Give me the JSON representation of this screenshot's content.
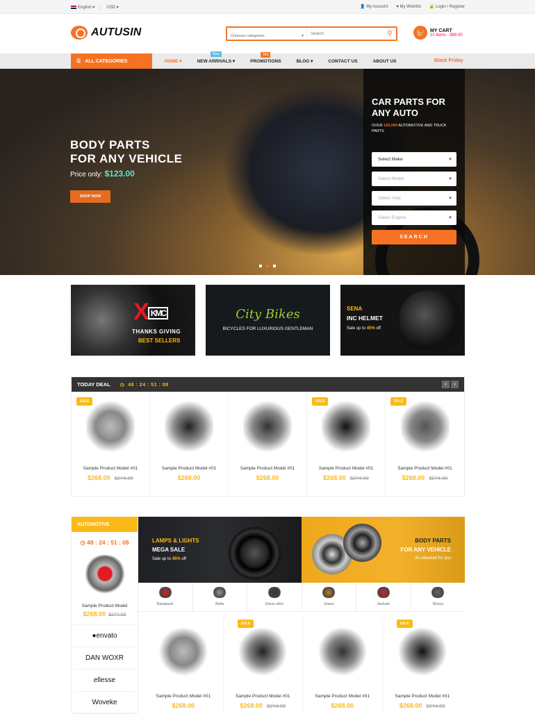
{
  "topbar": {
    "language": "English",
    "currency": "USD",
    "account": "My Account",
    "wishlist": "My Wishlist",
    "login": "Login / Register"
  },
  "header": {
    "logo": "AUTUSIN",
    "search_category": "Chooses categories",
    "search_placeholder": "Search",
    "cart_title": "MY CART",
    "cart_summary": "10 Items - $99.00"
  },
  "nav": {
    "all_categories": "ALL CATEGORIES",
    "items": [
      {
        "label": "HOME",
        "caret": "▾",
        "active": true,
        "badge": ""
      },
      {
        "label": "NEW ARRIVALS",
        "caret": "▾",
        "badge": "New"
      },
      {
        "label": "PROMOTIONS",
        "caret": "",
        "badge": "Hot"
      },
      {
        "label": "BLOG",
        "caret": "▾",
        "badge": ""
      },
      {
        "label": "CONTACT US",
        "caret": "",
        "badge": ""
      },
      {
        "label": "ABOUT US",
        "caret": "",
        "badge": ""
      }
    ],
    "promo": "Black Friday"
  },
  "hero": {
    "title_line1": "BODY PARTS",
    "title_line2": "FOR ANY VEHICLE",
    "price_label": "Price only:",
    "price": "$123.00",
    "cta": "SHOP NOW",
    "slides": 3,
    "active_slide": 2,
    "finder": {
      "title_line1": "CAR PARTS FOR",
      "title_line2": "ANY AUTO",
      "sub_prefix": "OVER",
      "sub_count": "120,000",
      "sub_suffix": "AUTOMOTIVE AND TRUCK PARTS",
      "selects": [
        "Select Make",
        "Select Model",
        "Select Year",
        "Select Engine"
      ],
      "button": "SEARCH"
    }
  },
  "banners": [
    {
      "logo": "XD",
      "logo_sub": "KMC",
      "line1": "THANKS GIVING",
      "line2": "BEST SELLERS"
    },
    {
      "title": "City Bikes",
      "subtitle": "BICYCLES FOR LUXURIOUS GENTLEMAN"
    },
    {
      "brand": "SENA",
      "title": "INC HELMET",
      "sale_prefix": "Sale up to",
      "sale_value": "45%",
      "sale_suffix": "off"
    }
  ],
  "today_deal": {
    "title": "TODAY DEAL",
    "timer": "48 : 24 : 51 : 08",
    "prev": "‹",
    "next": "›",
    "products": [
      {
        "name": "Sample Product Model #01",
        "price": "$268.00",
        "old_price": "$274.00",
        "sale": true
      },
      {
        "name": "Sample Product Model #01",
        "price": "$268.00",
        "old_price": "",
        "sale": false
      },
      {
        "name": "Sample Product Model #01",
        "price": "$268.00",
        "old_price": "",
        "sale": false
      },
      {
        "name": "Sample Product Model #01",
        "price": "$268.00",
        "old_price": "$274.00",
        "sale": true
      },
      {
        "name": "Sample Product Model #01",
        "price": "$268.00",
        "old_price": "$274.00",
        "sale": true
      }
    ],
    "sale_label": "SALE"
  },
  "automotive": {
    "title": "AUTOMOTIVE",
    "timer": "48 : 24 : 51 : 08",
    "product_name": "Sample Product Model",
    "price": "$268.00",
    "old_price": "$274.00",
    "brands": [
      "●envato",
      "DAN WOXR",
      "ellesse",
      "Woveke"
    ],
    "banner1": {
      "line1": "LAMPS & LIGHTS",
      "line2": "MEGA SALE",
      "sale_prefix": "Sale up to",
      "sale_value": "45%",
      "sale_suffix": "off"
    },
    "banner2": {
      "line1": "BODY PARTS",
      "line2": "FOR ANY VEHICLE",
      "line3": "An absolute for you"
    },
    "categories": [
      "Backpack",
      "Belts",
      "Dress shirt",
      "Jeans",
      "Jackets",
      "Shoes"
    ],
    "products": [
      {
        "name": "Sample Product Model #01",
        "price": "$268.00",
        "old_price": "",
        "sale": false
      },
      {
        "name": "Sample Product Model #01",
        "price": "$268.00",
        "old_price": "$274.00",
        "sale": true
      },
      {
        "name": "Sample Product Model #01",
        "price": "$268.00",
        "old_price": "",
        "sale": false
      },
      {
        "name": "Sample Product Model #01",
        "price": "$268.00",
        "old_price": "$274.00",
        "sale": true
      }
    ]
  },
  "colors": {
    "accent": "#f57224",
    "yellow": "#fbb917",
    "teal": "#5fe3c7",
    "dark": "#333333"
  }
}
